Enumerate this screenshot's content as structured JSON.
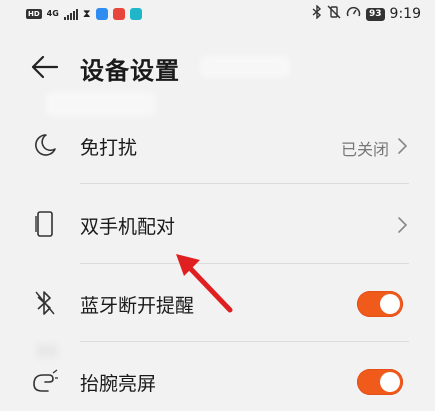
{
  "status_bar": {
    "hd": "HD",
    "network": "4G",
    "battery": "93",
    "time": "9:19",
    "icons": [
      "hd-icon",
      "signal-icon",
      "hourglass-icon",
      "app-icon-blue",
      "app-icon-red",
      "app-icon-teal",
      "bluetooth-icon",
      "vibrate-icon",
      "speed-icon"
    ]
  },
  "header": {
    "back_icon": "back-arrow-icon",
    "title": "设备设置"
  },
  "settings": {
    "items": [
      {
        "label": "免打扰",
        "value": "已关闭",
        "icon": "moon-icon",
        "control": "chevron"
      },
      {
        "label": "双手机配对",
        "value": "",
        "icon": "phone-icon",
        "control": "chevron"
      },
      {
        "label": "蓝牙断开提醒",
        "icon": "bluetooth-off-icon",
        "control": "toggle",
        "on": true
      },
      {
        "label": "抬腕亮屏",
        "icon": "wrist-raise-icon",
        "control": "toggle",
        "on": true
      }
    ]
  },
  "colors": {
    "accent": "#f05a1a",
    "annotation": "#e02020",
    "background": "#f2f2f2",
    "text_primary": "#1a1a1a",
    "text_secondary": "#777777"
  }
}
